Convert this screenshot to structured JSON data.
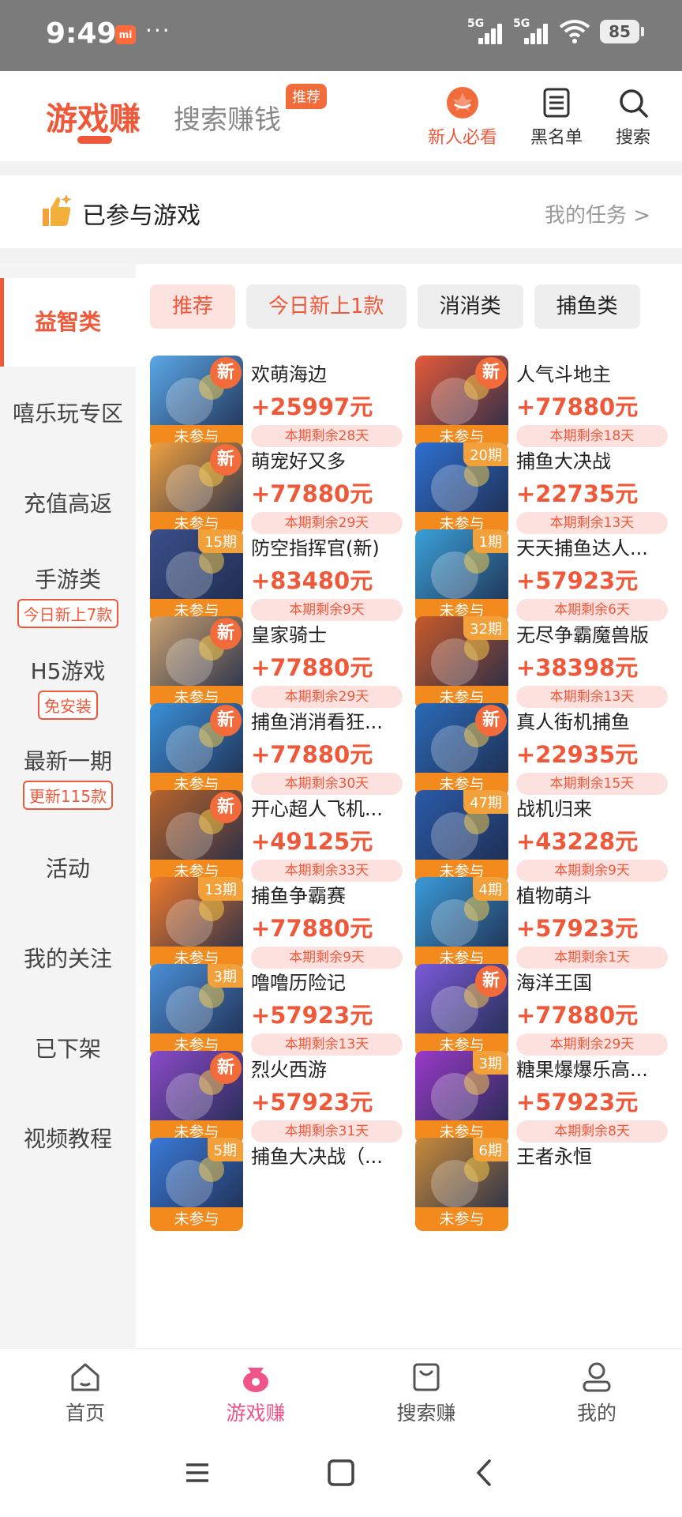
{
  "status": {
    "time": "9:49",
    "mi_label": "mi",
    "dots": "···",
    "net1": "5G",
    "net2": "5G",
    "battery": "85"
  },
  "header": {
    "tab_main": "游戏赚",
    "tab_second": "搜索赚钱",
    "tab_second_tag": "推荐",
    "actions": [
      {
        "label": "新人必看",
        "icon": "star-icon"
      },
      {
        "label": "黑名单",
        "icon": "list-icon"
      },
      {
        "label": "搜索",
        "icon": "search-icon"
      }
    ]
  },
  "joined": {
    "title": "已参与游戏",
    "link": "我的任务 >"
  },
  "sidebar": {
    "items": [
      {
        "label": "益智类"
      },
      {
        "label": "嘻乐玩专区"
      },
      {
        "label": "充值高返"
      },
      {
        "label": "手游类",
        "sub": "今日新上7款"
      },
      {
        "label": "H5游戏",
        "sub": "免安装"
      },
      {
        "label": "最新一期",
        "sub": "更新115款"
      },
      {
        "label": "活动"
      },
      {
        "label": "我的关注"
      },
      {
        "label": "已下架"
      },
      {
        "label": "视频教程"
      }
    ]
  },
  "chips": [
    "推荐",
    "今日新上1款",
    "消消类",
    "捕鱼类"
  ],
  "not_joined_label": "未参与",
  "games": [
    {
      "name": "欢萌海边",
      "reward": "+25997元",
      "remain": "本期剩余28天",
      "badge": "新",
      "color": "#5aa8e8"
    },
    {
      "name": "人气斗地主",
      "reward": "+77880元",
      "remain": "本期剩余18天",
      "badge": "新",
      "color": "#e45a3a"
    },
    {
      "name": "萌宠好又多",
      "reward": "+77880元",
      "remain": "本期剩余29天",
      "badge": "新",
      "color": "#f0a040"
    },
    {
      "name": "捕鱼大决战",
      "reward": "+22735元",
      "remain": "本期剩余13天",
      "badge": "20期",
      "color": "#2e6fcf"
    },
    {
      "name": "防空指挥官(新)",
      "reward": "+83480元",
      "remain": "本期剩余9天",
      "badge": "15期",
      "color": "#3a4f8a"
    },
    {
      "name": "天天捕鱼达人...",
      "reward": "+57923元",
      "remain": "本期剩余6天",
      "badge": "1期",
      "color": "#3aa0d8"
    },
    {
      "name": "皇家骑士",
      "reward": "+77880元",
      "remain": "本期剩余29天",
      "badge": "新",
      "color": "#c9a070"
    },
    {
      "name": "无尽争霸魔兽版",
      "reward": "+38398元",
      "remain": "本期剩余13天",
      "badge": "32期",
      "color": "#c85a2a"
    },
    {
      "name": "捕鱼消消看狂...",
      "reward": "+77880元",
      "remain": "本期剩余30天",
      "badge": "新",
      "color": "#3a8fd8"
    },
    {
      "name": "真人街机捕鱼",
      "reward": "+22935元",
      "remain": "本期剩余15天",
      "badge": "新",
      "color": "#2a6ab8"
    },
    {
      "name": "开心超人飞机...",
      "reward": "+49125元",
      "remain": "本期剩余33天",
      "badge": "新",
      "color": "#b8642a"
    },
    {
      "name": "战机归来",
      "reward": "+43228元",
      "remain": "本期剩余9天",
      "badge": "47期",
      "color": "#2a5aa8"
    },
    {
      "name": "捕鱼争霸赛",
      "reward": "+77880元",
      "remain": "本期剩余9天",
      "badge": "13期",
      "color": "#f07a2a"
    },
    {
      "name": "植物萌斗",
      "reward": "+57923元",
      "remain": "本期剩余1天",
      "badge": "4期",
      "color": "#3a9ad8"
    },
    {
      "name": "噜噜历险记",
      "reward": "+57923元",
      "remain": "本期剩余13天",
      "badge": "3期",
      "color": "#4a8fd8"
    },
    {
      "name": "海洋王国",
      "reward": "+77880元",
      "remain": "本期剩余29天",
      "badge": "新",
      "color": "#7a5ad8"
    },
    {
      "name": "烈火西游",
      "reward": "+57923元",
      "remain": "本期剩余31天",
      "badge": "新",
      "color": "#8a4ac8"
    },
    {
      "name": "糖果爆爆乐高...",
      "reward": "+57923元",
      "remain": "本期剩余8天",
      "badge": "3期",
      "color": "#9a3ac8"
    },
    {
      "name": "捕鱼大决战（...",
      "reward": "",
      "remain": "",
      "badge": "5期",
      "color": "#3a7ad8"
    },
    {
      "name": "王者永恒",
      "reward": "",
      "remain": "",
      "badge": "6期",
      "color": "#c88a3a"
    }
  ],
  "bottom_nav": [
    {
      "label": "首页",
      "icon": "home-icon"
    },
    {
      "label": "游戏赚",
      "icon": "game-bag-icon"
    },
    {
      "label": "搜索赚",
      "icon": "shopping-bag-icon"
    },
    {
      "label": "我的",
      "icon": "user-icon"
    }
  ],
  "system_nav": [
    "menu-icon",
    "home-square-icon",
    "back-icon"
  ]
}
